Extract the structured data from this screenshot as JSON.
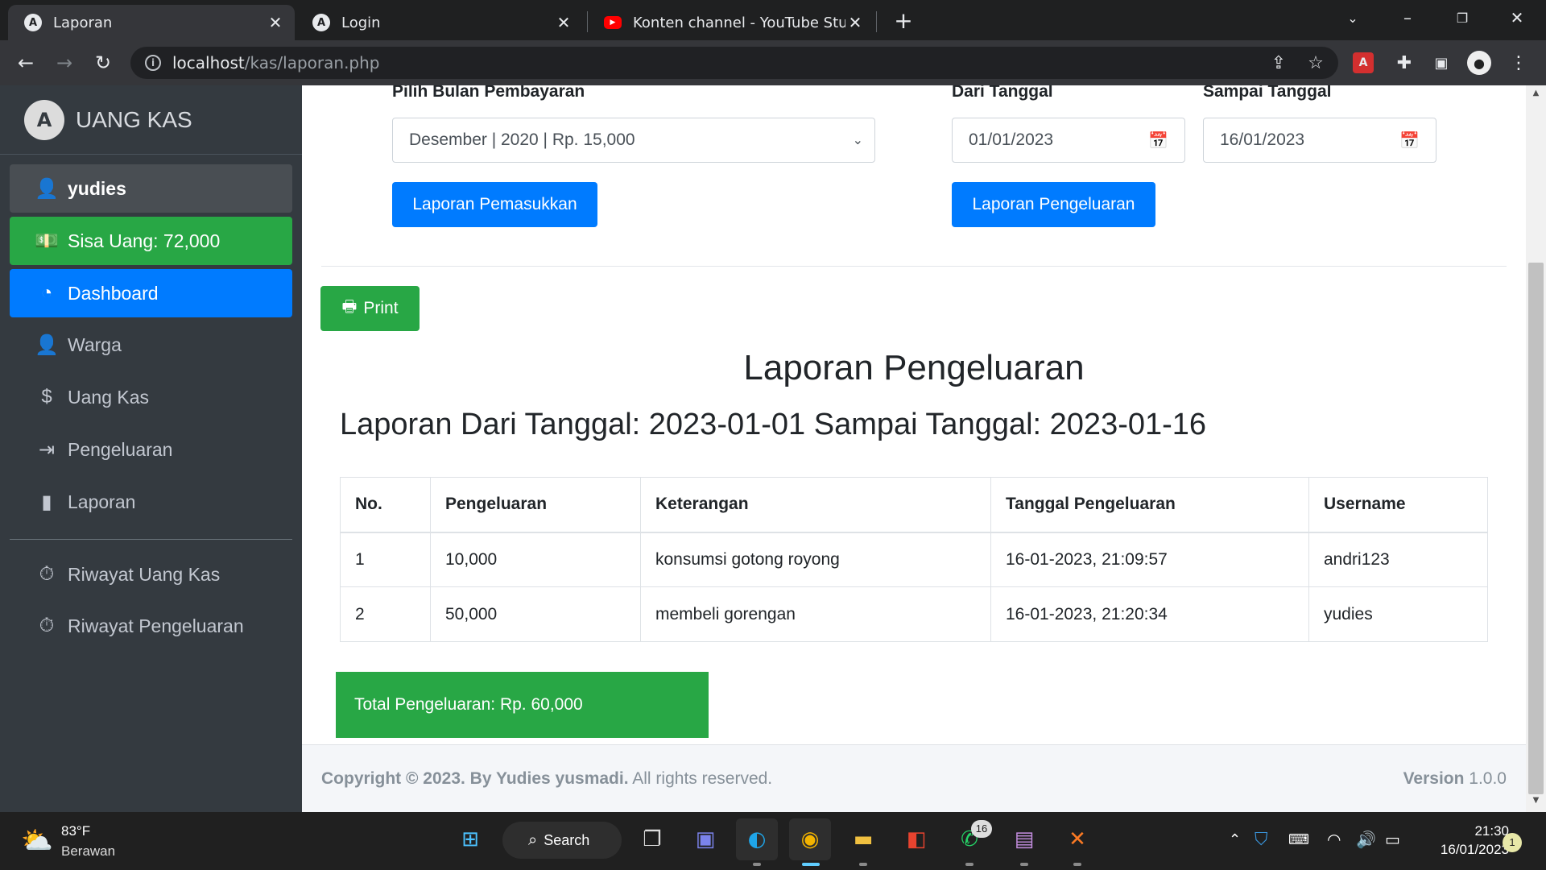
{
  "browser": {
    "tabs": [
      {
        "title": "Laporan",
        "favicon": "A",
        "active": true
      },
      {
        "title": "Login",
        "favicon": "A",
        "active": false
      },
      {
        "title": "Konten channel - YouTube Studio",
        "favicon": "youtube-icon",
        "active": false
      }
    ],
    "url_host": "localhost",
    "url_path": "/kas/laporan.php"
  },
  "sidebar": {
    "brand": "UANG KAS",
    "user": "yudies",
    "balance": "Sisa Uang: 72,000",
    "items": [
      {
        "label": "Dashboard",
        "icon": "gauge-icon"
      },
      {
        "label": "Warga",
        "icon": "user-tie-icon"
      },
      {
        "label": "Uang Kas",
        "icon": "dollar-icon"
      },
      {
        "label": "Pengeluaran",
        "icon": "sign-out-icon"
      },
      {
        "label": "Laporan",
        "icon": "file-icon"
      },
      {
        "label": "Riwayat Uang Kas",
        "icon": "stopwatch-icon"
      },
      {
        "label": "Riwayat Pengeluaran",
        "icon": "stopwatch-icon"
      }
    ]
  },
  "form": {
    "month_label": "Pilih Bulan Pembayaran",
    "month_value": "Desember | 2020 | Rp. 15,000",
    "from_label": "Dari Tanggal",
    "from_value": "01/01/2023",
    "to_label": "Sampai Tanggal",
    "to_value": "16/01/2023",
    "income_button": "Laporan Pemasukkan",
    "expense_button": "Laporan Pengeluaran",
    "print_button": "Print"
  },
  "report": {
    "title": "Laporan Pengeluaran",
    "subtitle": "Laporan Dari Tanggal: 2023-01-01 Sampai Tanggal: 2023-01-16",
    "columns": [
      "No.",
      "Pengeluaran",
      "Keterangan",
      "Tanggal Pengeluaran",
      "Username"
    ],
    "rows": [
      [
        "1",
        "10,000",
        "konsumsi gotong royong",
        "16-01-2023, 21:09:57",
        "andri123"
      ],
      [
        "2",
        "50,000",
        "membeli gorengan",
        "16-01-2023, 21:20:34",
        "yudies"
      ]
    ],
    "total": "Total Pengeluaran: Rp. 60,000"
  },
  "footer": {
    "copyright_bold": "Copyright © 2023. By Yudies yusmadi.",
    "copyright_rest": "All rights reserved.",
    "version_label": "Version",
    "version_value": "1.0.0"
  },
  "taskbar": {
    "weather_temp": "83°F",
    "weather_desc": "Berawan",
    "search": "Search",
    "whatsapp_badge": "16",
    "time": "21:30",
    "date": "16/01/2023",
    "notification_count": "1"
  }
}
